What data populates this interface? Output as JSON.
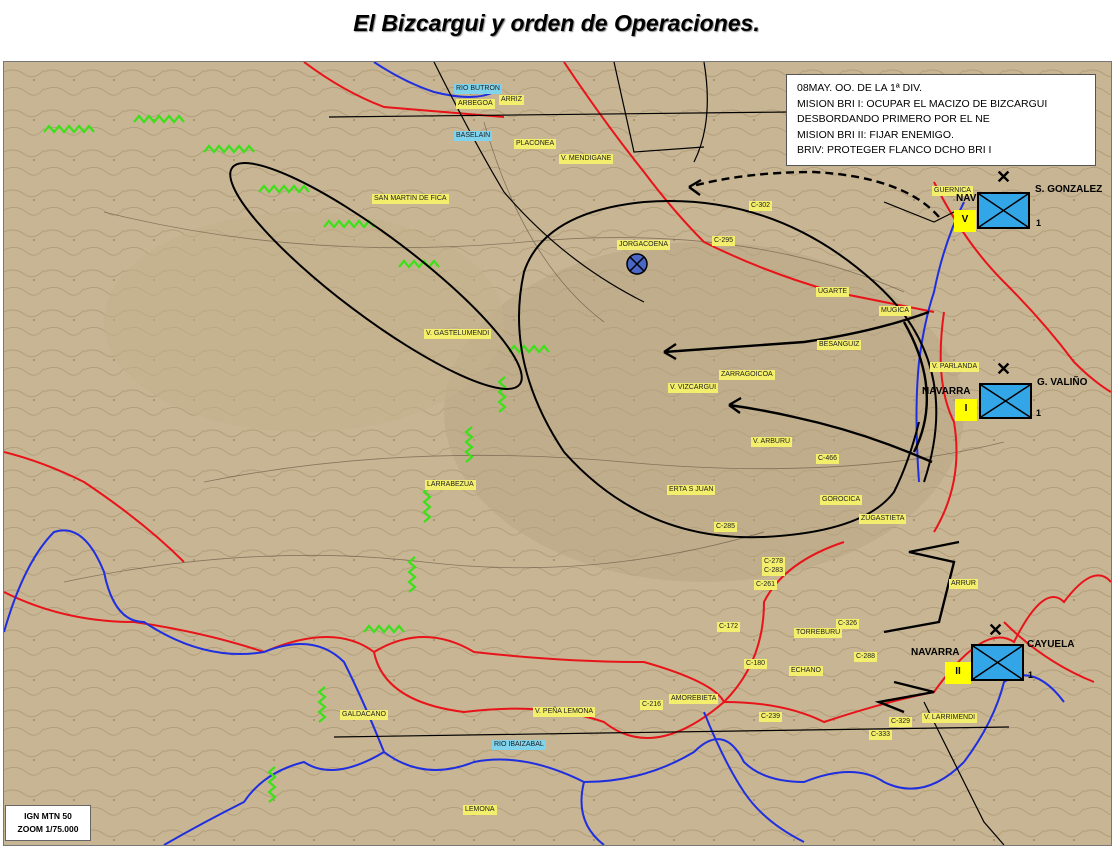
{
  "title": "El Bizcargui y orden de Operaciones.",
  "orders": {
    "lines": [
      "08MAY. OO.  DE LA 1ª DIV.",
      "MISION BRI I:  OCUPAR EL MACIZO DE BIZCARGUI",
      "DESBORDANDO PRIMERO POR EL NE",
      "MISION BRI II: FIJAR ENEMIGO.",
      "BRIV: PROTEGER FLANCO DCHO BRI I"
    ]
  },
  "units": [
    {
      "tag": "V",
      "name": "S. GONZALEZ",
      "side": "NAV",
      "num": "1"
    },
    {
      "tag": "I",
      "name": "G. VALIÑO",
      "side": "NAVARRA",
      "num": "1"
    },
    {
      "tag": "II",
      "name": "CAYUELA",
      "side": "NAVARRA",
      "num": "1"
    }
  ],
  "places": [
    "RIO BUTRON",
    "ARRIZ",
    "ARBEGOA",
    "BASELAIN",
    "PLACONEA",
    "V. MENDIGANE",
    "SAN MARTIN DE FICA",
    "JORGACOENA",
    "C-302",
    "C-295",
    "GUERNICA",
    "V. GASTELUMENDI",
    "UGARTE",
    "MUGICA",
    "BESANGUIZ",
    "ZARRAGOICOA",
    "V. VIZCARGUI",
    "V. PARLANDA",
    "V. ARBURU",
    "C-466",
    "LARRABEZUA",
    "ERTA S JUAN",
    "GOROCICA",
    "C-285",
    "ZUGASTIETA",
    "C-278",
    "C-283",
    "C-261",
    "ARRUR",
    "C-172",
    "TORREBURU",
    "C-326",
    "C-288",
    "C-180",
    "ECHANO",
    "AMOREBIETA",
    "C-216",
    "C-239",
    "V. PEÑA LEMONA",
    "GALDACANO",
    "RIO IBAIZABAL",
    "C-329",
    "V. LARRIMENDI",
    "C-333",
    "LEMONA"
  ],
  "legend": {
    "line1": "IGN MTN 50",
    "line2": "ZOOM 1/75.000"
  },
  "colors": {
    "river": "#1f2fe0",
    "boundary": "#e8141a",
    "front": "#3ee01a",
    "unit_fill": "#33a6e8",
    "unit_tag": "#ffff00",
    "place_tag": "#f3ee6b"
  },
  "icons": {
    "objective": "circle-cross-icon",
    "hq": "x-mark-icon"
  }
}
